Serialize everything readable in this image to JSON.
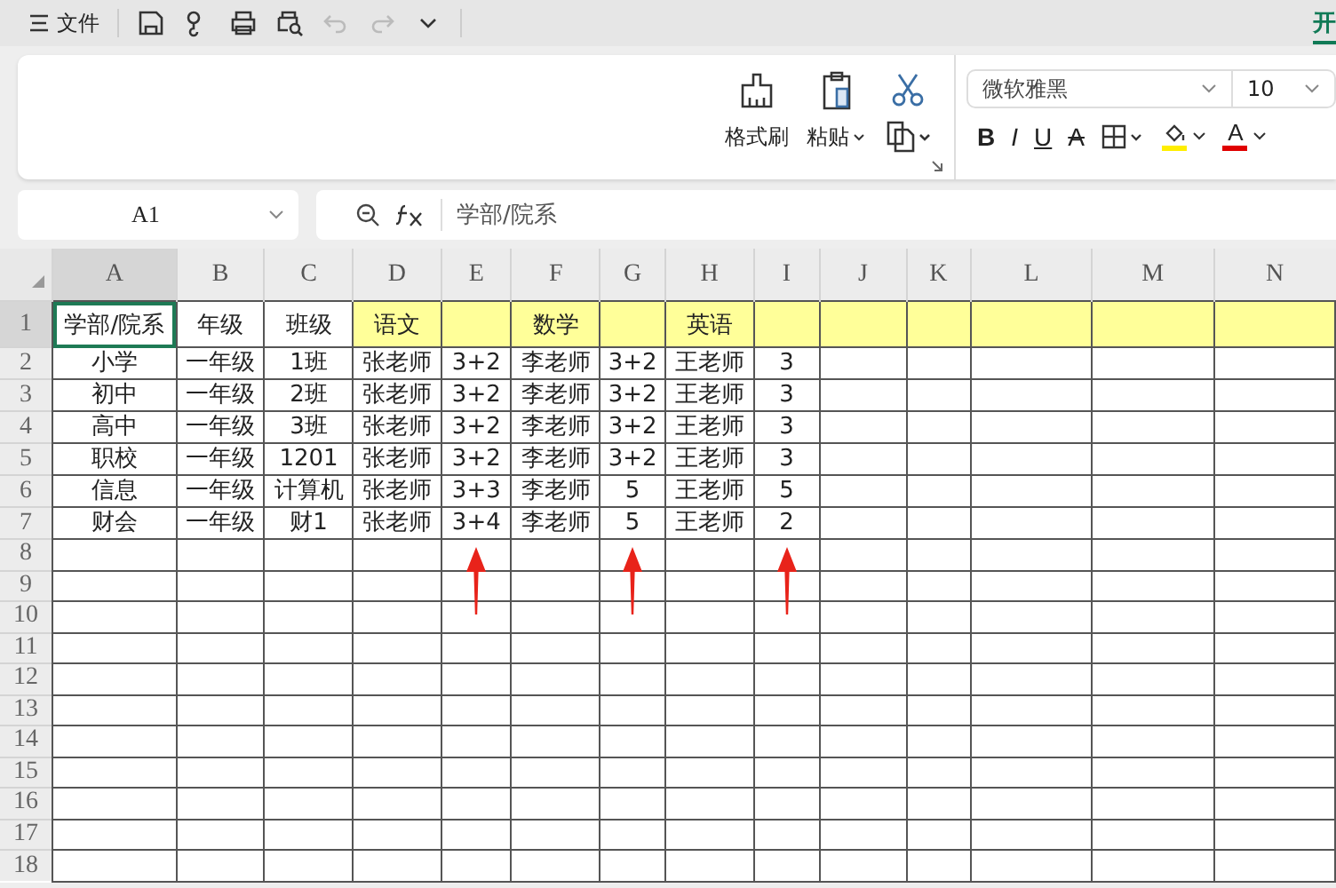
{
  "menu": {
    "label": "文件"
  },
  "quick_access": [
    {
      "kind": "save",
      "disabled": false
    },
    {
      "kind": "share",
      "disabled": false
    },
    {
      "kind": "print",
      "disabled": false
    },
    {
      "kind": "preview",
      "disabled": false
    },
    {
      "kind": "undo",
      "disabled": true
    },
    {
      "kind": "redo",
      "disabled": true
    },
    {
      "kind": "more",
      "disabled": false
    }
  ],
  "tabs": [
    {
      "label": "开",
      "selected": true
    }
  ],
  "ribbon": {
    "format_painter": "格式刷",
    "paste": "粘贴",
    "font": "微软雅黑",
    "font_size": "10",
    "format_buttons": [
      {
        "kind": "bold",
        "glyph": "B"
      },
      {
        "kind": "italic",
        "glyph": "I"
      },
      {
        "kind": "underline",
        "glyph": "U"
      },
      {
        "kind": "strike",
        "glyph": "A"
      },
      {
        "kind": "borders"
      },
      {
        "kind": "fill",
        "color": "#ffee00"
      },
      {
        "kind": "font-color",
        "glyph": "A",
        "color": "#e00000"
      }
    ]
  },
  "formula_bar": {
    "cell": "A1",
    "value": "学部/院系"
  },
  "columns": [
    {
      "label": "A",
      "selected": true,
      "highlighted": false,
      "arrow": false
    },
    {
      "label": "B",
      "selected": false,
      "highlighted": false,
      "arrow": false
    },
    {
      "label": "C",
      "selected": false,
      "highlighted": false,
      "arrow": false
    },
    {
      "label": "D",
      "selected": false,
      "highlighted": true,
      "arrow": false
    },
    {
      "label": "E",
      "selected": false,
      "highlighted": true,
      "arrow": true
    },
    {
      "label": "F",
      "selected": false,
      "highlighted": true,
      "arrow": false
    },
    {
      "label": "G",
      "selected": false,
      "highlighted": true,
      "arrow": true
    },
    {
      "label": "H",
      "selected": false,
      "highlighted": true,
      "arrow": false
    },
    {
      "label": "I",
      "selected": false,
      "highlighted": true,
      "arrow": true
    },
    {
      "label": "J",
      "selected": false,
      "highlighted": true,
      "arrow": false
    },
    {
      "label": "K",
      "selected": false,
      "highlighted": true,
      "arrow": false
    },
    {
      "label": "L",
      "selected": false,
      "highlighted": true,
      "arrow": false
    },
    {
      "label": "M",
      "selected": false,
      "highlighted": true,
      "arrow": false
    },
    {
      "label": "N",
      "selected": false,
      "highlighted": true,
      "arrow": false
    }
  ],
  "rows": [
    {
      "label": "1",
      "selected": true,
      "cells": [
        "学部/院系",
        "年级",
        "班级",
        "语文",
        null,
        "数学",
        null,
        "英语",
        null
      ]
    },
    {
      "label": "2",
      "selected": false,
      "cells": [
        "小学",
        "一年级",
        "1班",
        "张老师",
        "3+2",
        "李老师",
        "3+2",
        "王老师",
        "3"
      ]
    },
    {
      "label": "3",
      "selected": false,
      "cells": [
        "初中",
        "一年级",
        "2班",
        "张老师",
        "3+2",
        "李老师",
        "3+2",
        "王老师",
        "3"
      ]
    },
    {
      "label": "4",
      "selected": false,
      "cells": [
        "高中",
        "一年级",
        "3班",
        "张老师",
        "3+2",
        "李老师",
        "3+2",
        "王老师",
        "3"
      ]
    },
    {
      "label": "5",
      "selected": false,
      "cells": [
        "职校",
        "一年级",
        "1201",
        "张老师",
        "3+2",
        "李老师",
        "3+2",
        "王老师",
        "3"
      ]
    },
    {
      "label": "6",
      "selected": false,
      "cells": [
        "信息",
        "一年级",
        "计算机",
        "张老师",
        "3+3",
        "李老师",
        "5",
        "王老师",
        "5"
      ]
    },
    {
      "label": "7",
      "selected": false,
      "cells": [
        "财会",
        "一年级",
        "财1",
        "张老师",
        "3+4",
        "李老师",
        "5",
        "王老师",
        "2"
      ]
    },
    {
      "label": "8",
      "selected": false
    },
    {
      "label": "9",
      "selected": false
    },
    {
      "label": "10",
      "selected": false
    },
    {
      "label": "11",
      "selected": false
    },
    {
      "label": "12",
      "selected": false
    },
    {
      "label": "13",
      "selected": false
    },
    {
      "label": "14",
      "selected": false
    },
    {
      "label": "15",
      "selected": false
    },
    {
      "label": "16",
      "selected": false
    },
    {
      "label": "17",
      "selected": false
    },
    {
      "label": "18",
      "selected": false
    }
  ]
}
